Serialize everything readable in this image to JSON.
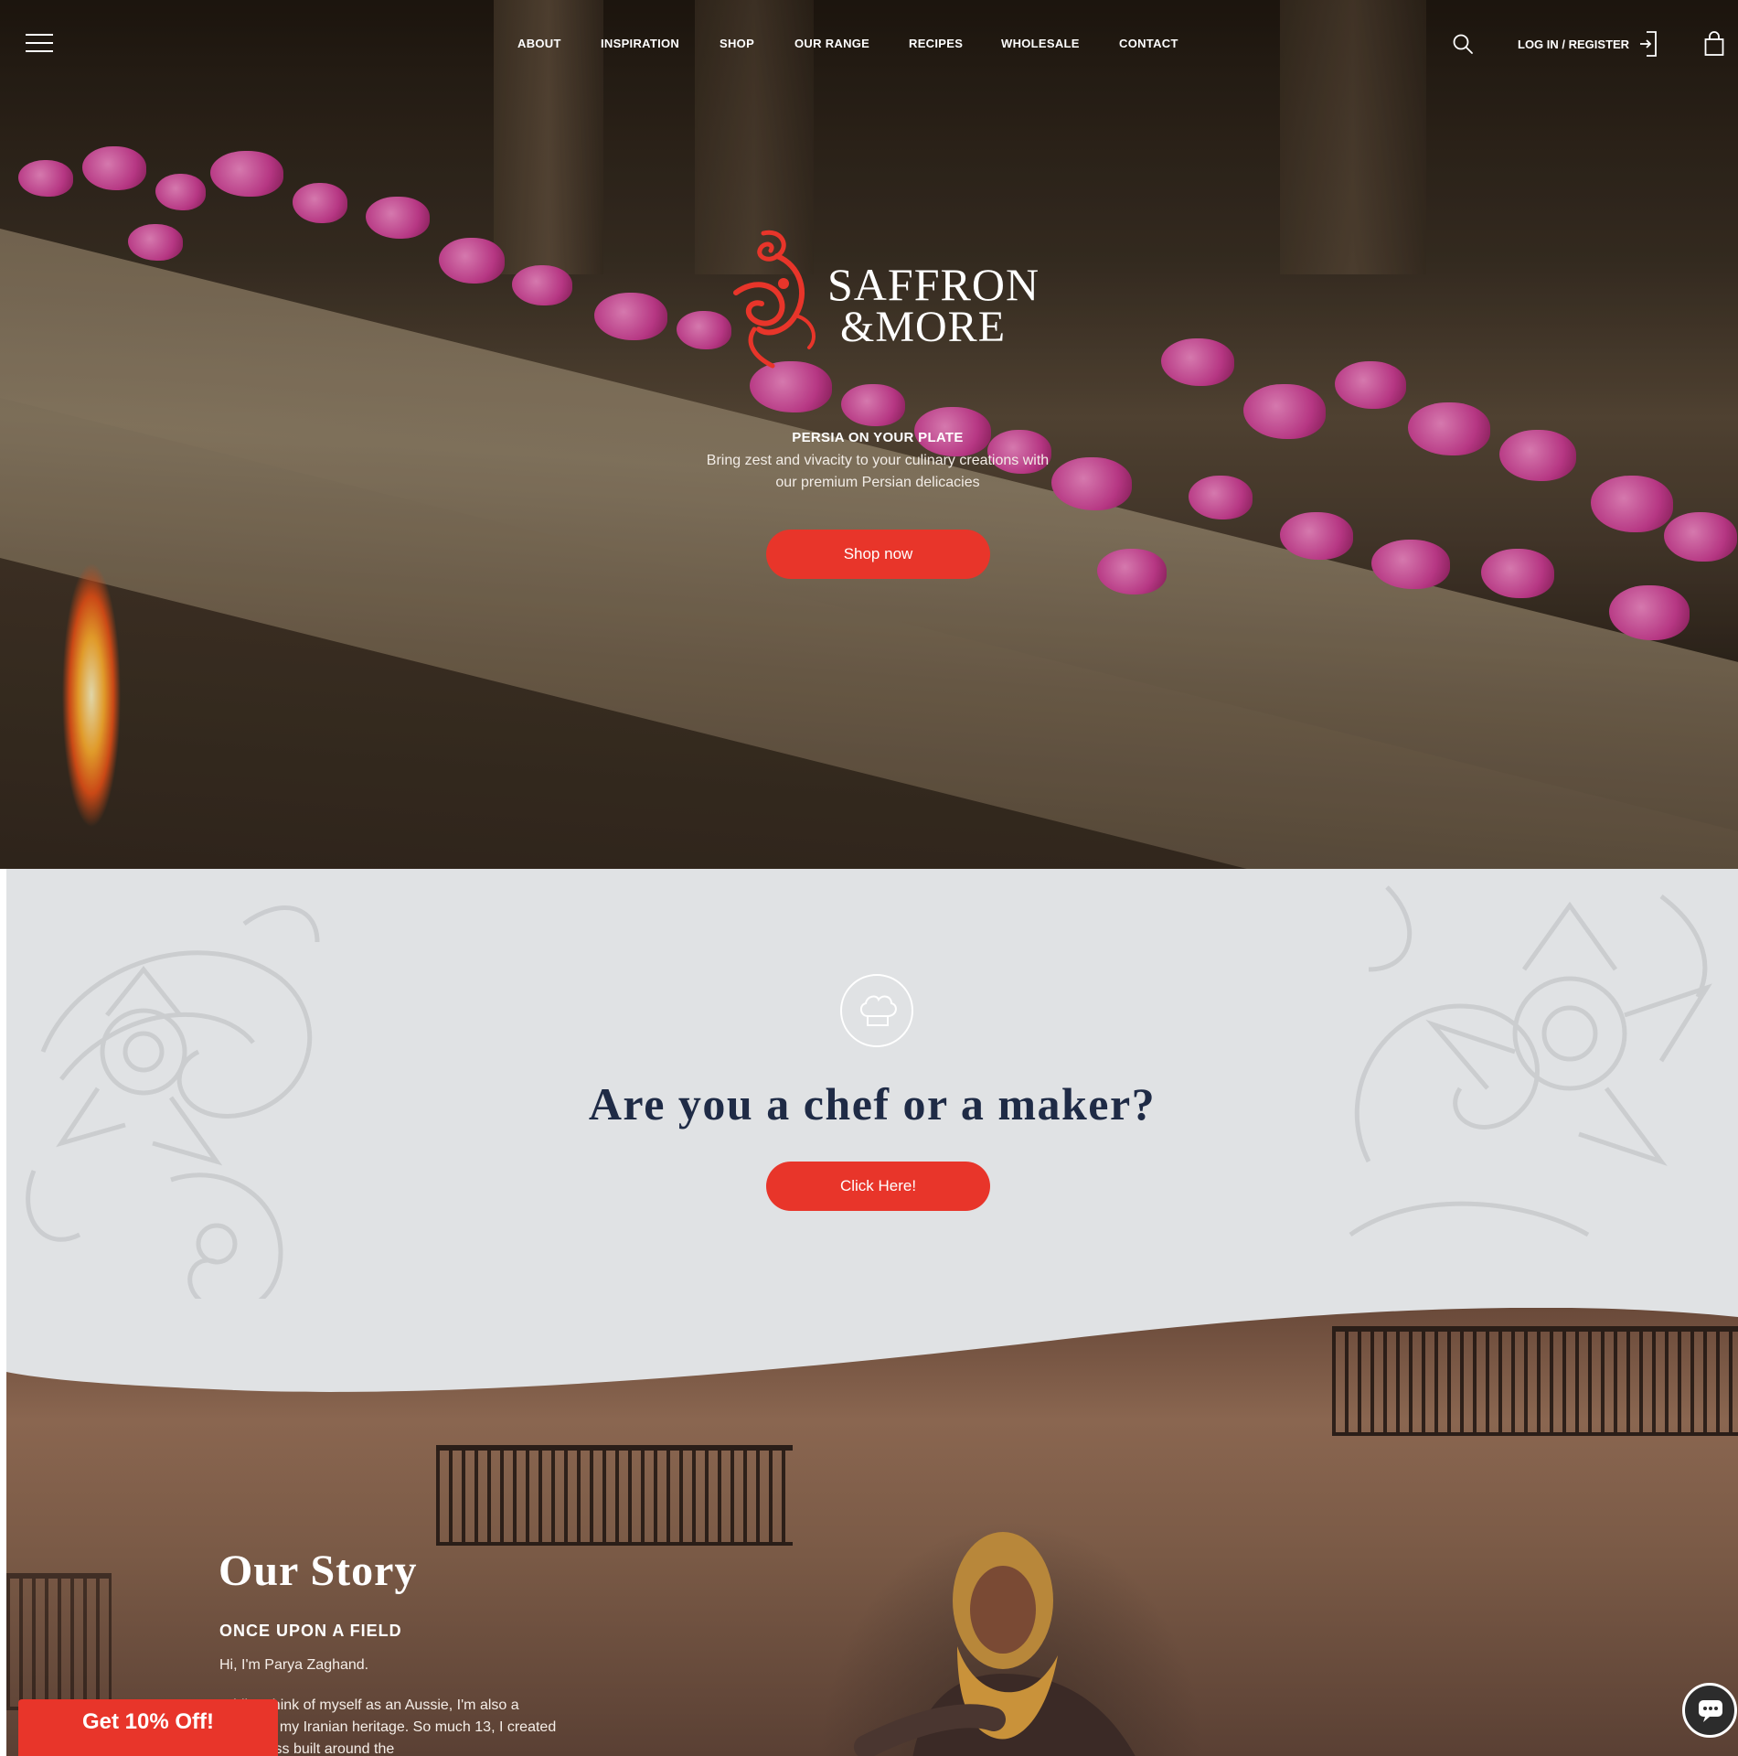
{
  "nav": {
    "items": [
      "ABOUT",
      "INSPIRATION",
      "SHOP",
      "OUR RANGE",
      "RECIPES",
      "WHOLESALE",
      "CONTACT"
    ],
    "login_label": "LOG IN / REGISTER",
    "icons": [
      "menu-icon",
      "search-icon",
      "login-icon",
      "bag-icon"
    ]
  },
  "brand": {
    "logo_line1": "SAFFRON",
    "logo_line2": "&MORE",
    "accent_color": "#e8352a"
  },
  "hero": {
    "tagline": "PERSIA ON YOUR PLATE",
    "subtitle": "Bring zest and vivacity to your culinary creations with our premium Persian delicacies",
    "cta_label": "Shop now"
  },
  "chef_section": {
    "icon": "chef-hat-icon",
    "title": "Are you a chef or a maker?",
    "cta_label": "Click Here!"
  },
  "story": {
    "title": "Our Story",
    "subtitle": "ONCE UPON A FIELD",
    "paragraph1": "Hi, I'm Parya Zaghand.",
    "paragraph2": "While I think of myself as an Aussie, I'm also a punch of my Iranian heritage. So much 13, I created a business built around the"
  },
  "promo": {
    "label": "Get 10% Off!"
  },
  "chat": {
    "icon": "chat-icon"
  }
}
